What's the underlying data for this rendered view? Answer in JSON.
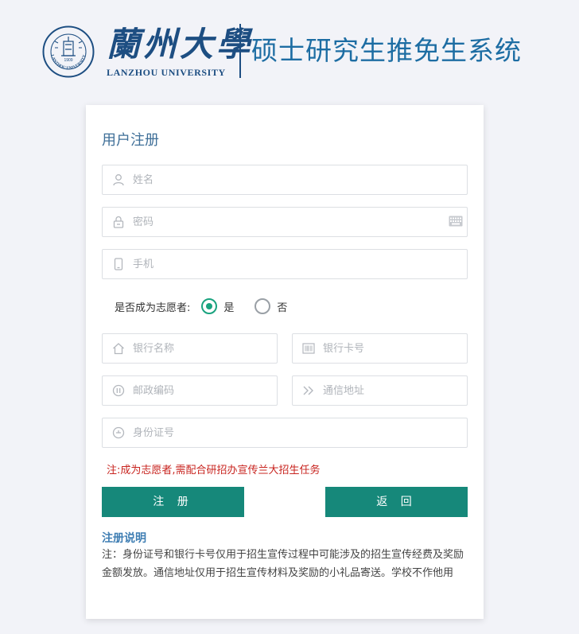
{
  "header": {
    "seal_text": "LANZHOU UNIVERSITY",
    "seal_year": "1909",
    "brand_cn": "蘭州大學",
    "brand_en": "LANZHOU UNIVERSITY",
    "system_title": "硕士研究生推免生系统",
    "brand_color": "#1d4e82"
  },
  "form": {
    "title": "用户注册",
    "name_placeholder": "姓名",
    "password_placeholder": "密码",
    "phone_placeholder": "手机",
    "volunteer_question": "是否成为志愿者:",
    "volunteer_yes": "是",
    "volunteer_no": "否",
    "volunteer_selected": "是",
    "bank_name_placeholder": "银行名称",
    "bank_card_placeholder": "银行卡号",
    "postcode_placeholder": "邮政编码",
    "address_placeholder": "通信地址",
    "id_placeholder": "身份证号",
    "volunteer_note": "注:成为志愿者,需配合研招办宣传兰大招生任务",
    "register_label": "注 册",
    "back_label": "返 回",
    "accent_color": "#16887a",
    "note_color": "#c8241f"
  },
  "explain": {
    "title": "注册说明",
    "body": "注：身份证号和银行卡号仅用于招生宣传过程中可能涉及的招生宣传经费及奖励金额发放。通信地址仅用于招生宣传材料及奖励的小礼品寄送。学校不作他用"
  }
}
